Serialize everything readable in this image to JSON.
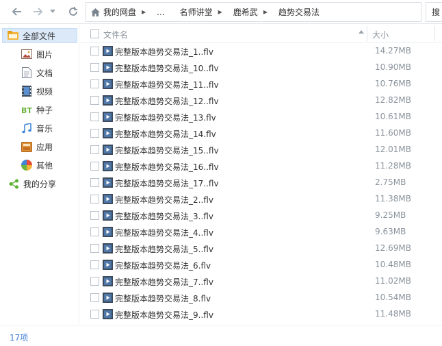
{
  "toolbar": {
    "breadcrumb": [
      {
        "label": "我的网盘"
      },
      {
        "label": "..."
      },
      {
        "label": "名师讲堂"
      },
      {
        "label": "鹿希武"
      },
      {
        "label": "趋势交易法"
      }
    ],
    "search_label": "搜"
  },
  "sidebar": {
    "items": [
      {
        "label": "全部文件",
        "icon": "folder-icon",
        "active": true
      },
      {
        "label": "图片",
        "icon": "image-icon"
      },
      {
        "label": "文档",
        "icon": "document-icon"
      },
      {
        "label": "视频",
        "icon": "video-icon"
      },
      {
        "label": "种子",
        "icon": "bt-icon"
      },
      {
        "label": "音乐",
        "icon": "music-icon"
      },
      {
        "label": "应用",
        "icon": "app-icon"
      },
      {
        "label": "其他",
        "icon": "other-icon"
      },
      {
        "label": "我的分享",
        "icon": "share-icon"
      }
    ]
  },
  "list": {
    "columns": {
      "name": "文件名",
      "size": "大小"
    },
    "files": [
      {
        "name": "完整版本趋势交易法_1..flv",
        "size": "14.27MB"
      },
      {
        "name": "完整版本趋势交易法_10..flv",
        "size": "10.90MB"
      },
      {
        "name": "完整版本趋势交易法_11..flv",
        "size": "10.76MB"
      },
      {
        "name": "完整版本趋势交易法_12..flv",
        "size": "12.82MB"
      },
      {
        "name": "完整版本趋势交易法_13.flv",
        "size": "10.61MB"
      },
      {
        "name": "完整版本趋势交易法_14.flv",
        "size": "11.60MB"
      },
      {
        "name": "完整版本趋势交易法_15..flv",
        "size": "12.01MB"
      },
      {
        "name": "完整版本趋势交易法_16..flv",
        "size": "11.28MB"
      },
      {
        "name": "完整版本趋势交易法_17..flv",
        "size": "2.75MB"
      },
      {
        "name": "完整版本趋势交易法_2..flv",
        "size": "11.38MB"
      },
      {
        "name": "完整版本趋势交易法_3..flv",
        "size": "9.25MB"
      },
      {
        "name": "完整版本趋势交易法_4..flv",
        "size": "9.63MB"
      },
      {
        "name": "完整版本趋势交易法_5..flv",
        "size": "12.69MB"
      },
      {
        "name": "完整版本趋势交易法_6.flv",
        "size": "10.48MB"
      },
      {
        "name": "完整版本趋势交易法_7..flv",
        "size": "11.02MB"
      },
      {
        "name": "完整版本趋势交易法_8.flv",
        "size": "10.54MB"
      },
      {
        "name": "完整版本趋势交易法_9..flv",
        "size": "11.48MB"
      }
    ]
  },
  "status": {
    "count_label": "17项"
  },
  "colors": {
    "accent": "#3b7bd6",
    "active_bg": "#dbe9f9"
  }
}
